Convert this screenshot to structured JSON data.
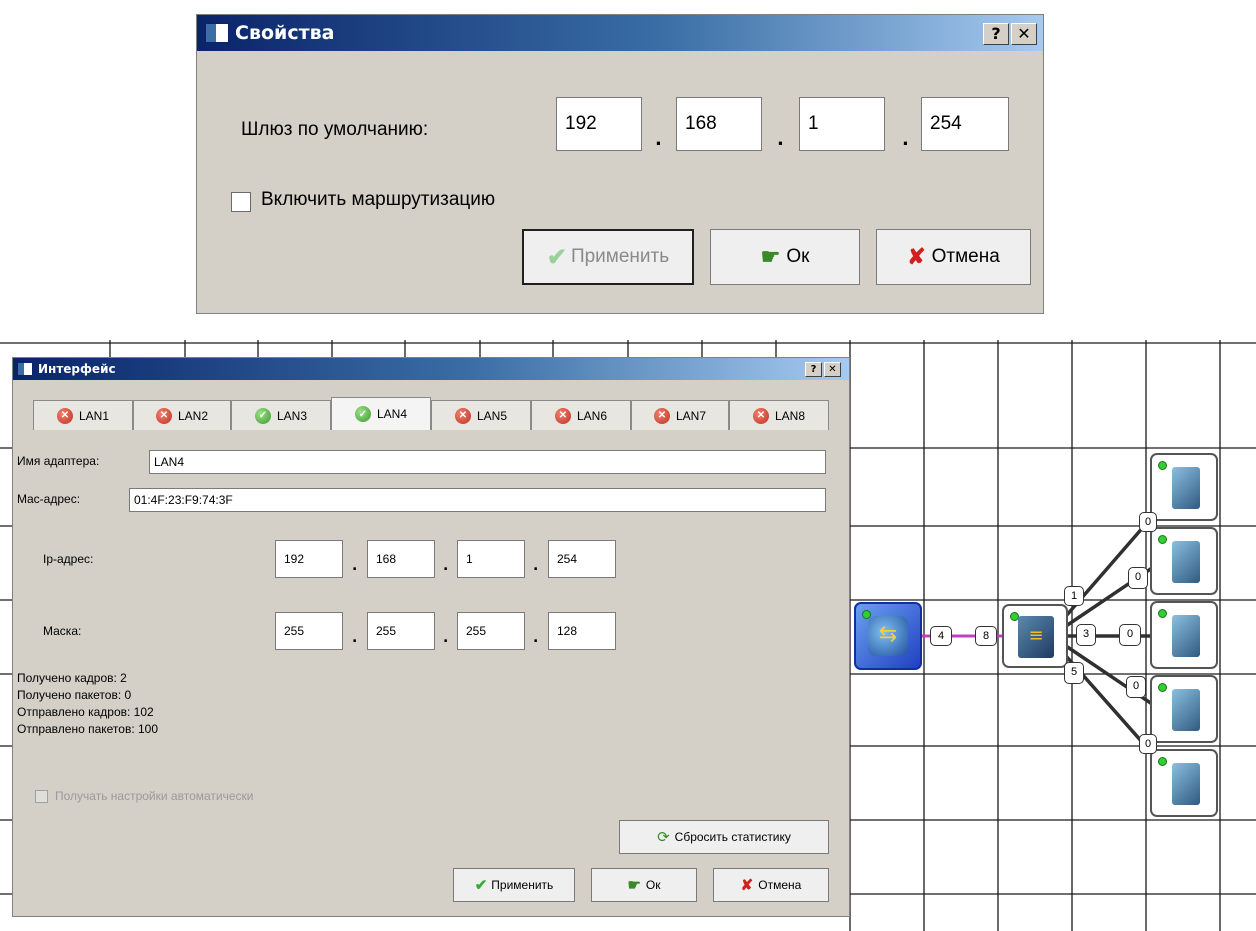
{
  "props_dialog": {
    "title": "Свойства",
    "help_btn": "?",
    "close_btn": "✕",
    "gateway_label": "Шлюз по умолчанию:",
    "gateway_octets": [
      "192",
      "168",
      "1",
      "254"
    ],
    "octet_sep": ".",
    "routing_label": "Включить маршрутизацию",
    "routing_checked": false,
    "apply_label": "Применить",
    "ok_label": "Ок",
    "cancel_label": "Отмена"
  },
  "iface_dialog": {
    "title": "Интерфейс",
    "help_btn": "?",
    "close_btn": "✕",
    "tabs": [
      {
        "label": "LAN1",
        "status": "error"
      },
      {
        "label": "LAN2",
        "status": "error"
      },
      {
        "label": "LAN3",
        "status": "ok"
      },
      {
        "label": "LAN4",
        "status": "ok",
        "active": true
      },
      {
        "label": "LAN5",
        "status": "error"
      },
      {
        "label": "LAN6",
        "status": "error"
      },
      {
        "label": "LAN7",
        "status": "error"
      },
      {
        "label": "LAN8",
        "status": "error"
      }
    ],
    "adapter_label": "Имя адаптера:",
    "adapter_value": "LAN4",
    "mac_label": "Mac-адрес:",
    "mac_value": "01:4F:23:F9:74:3F",
    "ip_label": "Ip-адрес:",
    "ip_octets": [
      "192",
      "168",
      "1",
      "254"
    ],
    "mask_label": "Маска:",
    "mask_octets": [
      "255",
      "255",
      "255",
      "128"
    ],
    "octet_sep": ".",
    "stats": {
      "rx_frames": "Получено кадров: 2",
      "rx_packets": "Получено пакетов: 0",
      "tx_frames": "Отправлено кадров: 102",
      "tx_packets": "Отправлено пакетов: 100"
    },
    "auto_label": "Получать настройки автоматически",
    "reset_label": "Сбросить статистику",
    "apply_label": "Применить",
    "ok_label": "Ок",
    "cancel_label": "Отмена"
  },
  "network": {
    "router_ports": [
      "4"
    ],
    "switch_ports": [
      "8",
      "1",
      "3",
      "5"
    ],
    "host_ports": [
      "0",
      "0",
      "0",
      "0",
      "0"
    ]
  }
}
